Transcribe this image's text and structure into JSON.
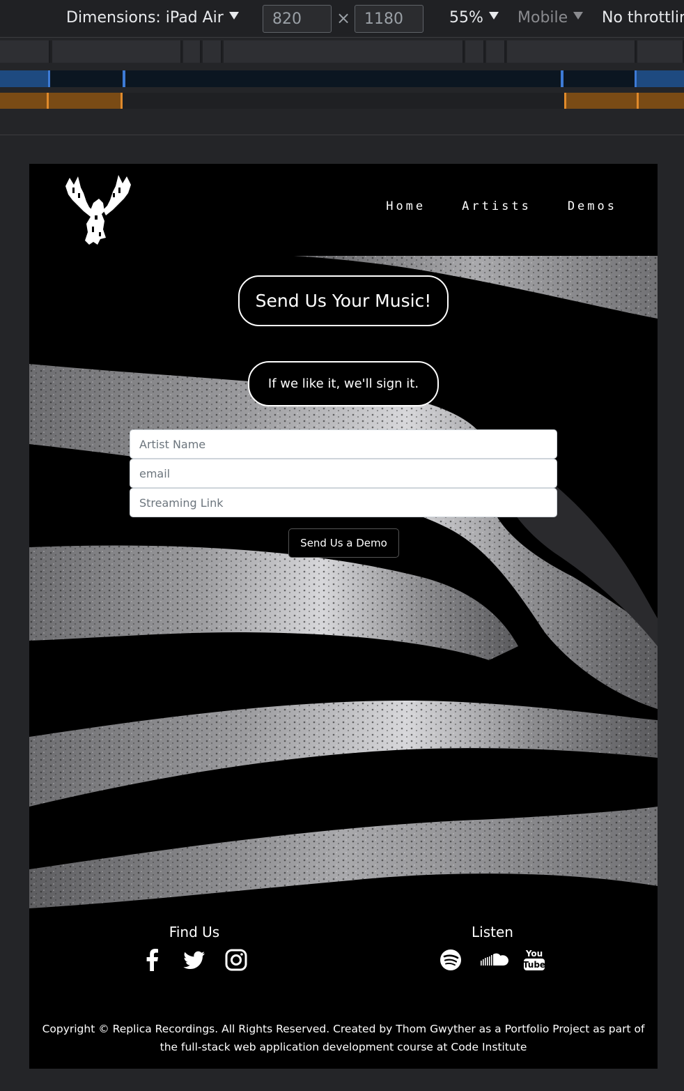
{
  "devtools": {
    "dimensions_label": "Dimensions: iPad Air",
    "width": "820",
    "times": "×",
    "height": "1180",
    "zoom": "55%",
    "mode": "Mobile",
    "throttle": "No throttlin"
  },
  "nav": {
    "items": [
      {
        "label": "Home"
      },
      {
        "label": "Artists"
      },
      {
        "label": "Demos"
      }
    ]
  },
  "hero": {
    "title": "Send Us Your Music!",
    "subtitle": "If we like it, we'll sign it."
  },
  "form": {
    "artist_placeholder": "Artist Name",
    "email_placeholder": "email",
    "link_placeholder": "Streaming Link",
    "submit_label": "Send Us a Demo"
  },
  "footer": {
    "find_title": "Find Us",
    "listen_title": "Listen",
    "find_icons": [
      "facebook-icon",
      "twitter-icon",
      "instagram-icon"
    ],
    "listen_icons": [
      "spotify-icon",
      "soundcloud-icon",
      "youtube-icon"
    ],
    "youtube_you": "You",
    "youtube_tube": "Tube",
    "copyright": "Copyright © Replica Recordings. All Rights Reserved. Created by Thom Gwyther as a Portfolio Project as part of the full-stack web application development course at Code Institute"
  },
  "colors": {
    "devtools_bg": "#202124",
    "media_blue": "#1e4a80",
    "media_orange": "#7a4b15",
    "page_bg": "#000000"
  }
}
